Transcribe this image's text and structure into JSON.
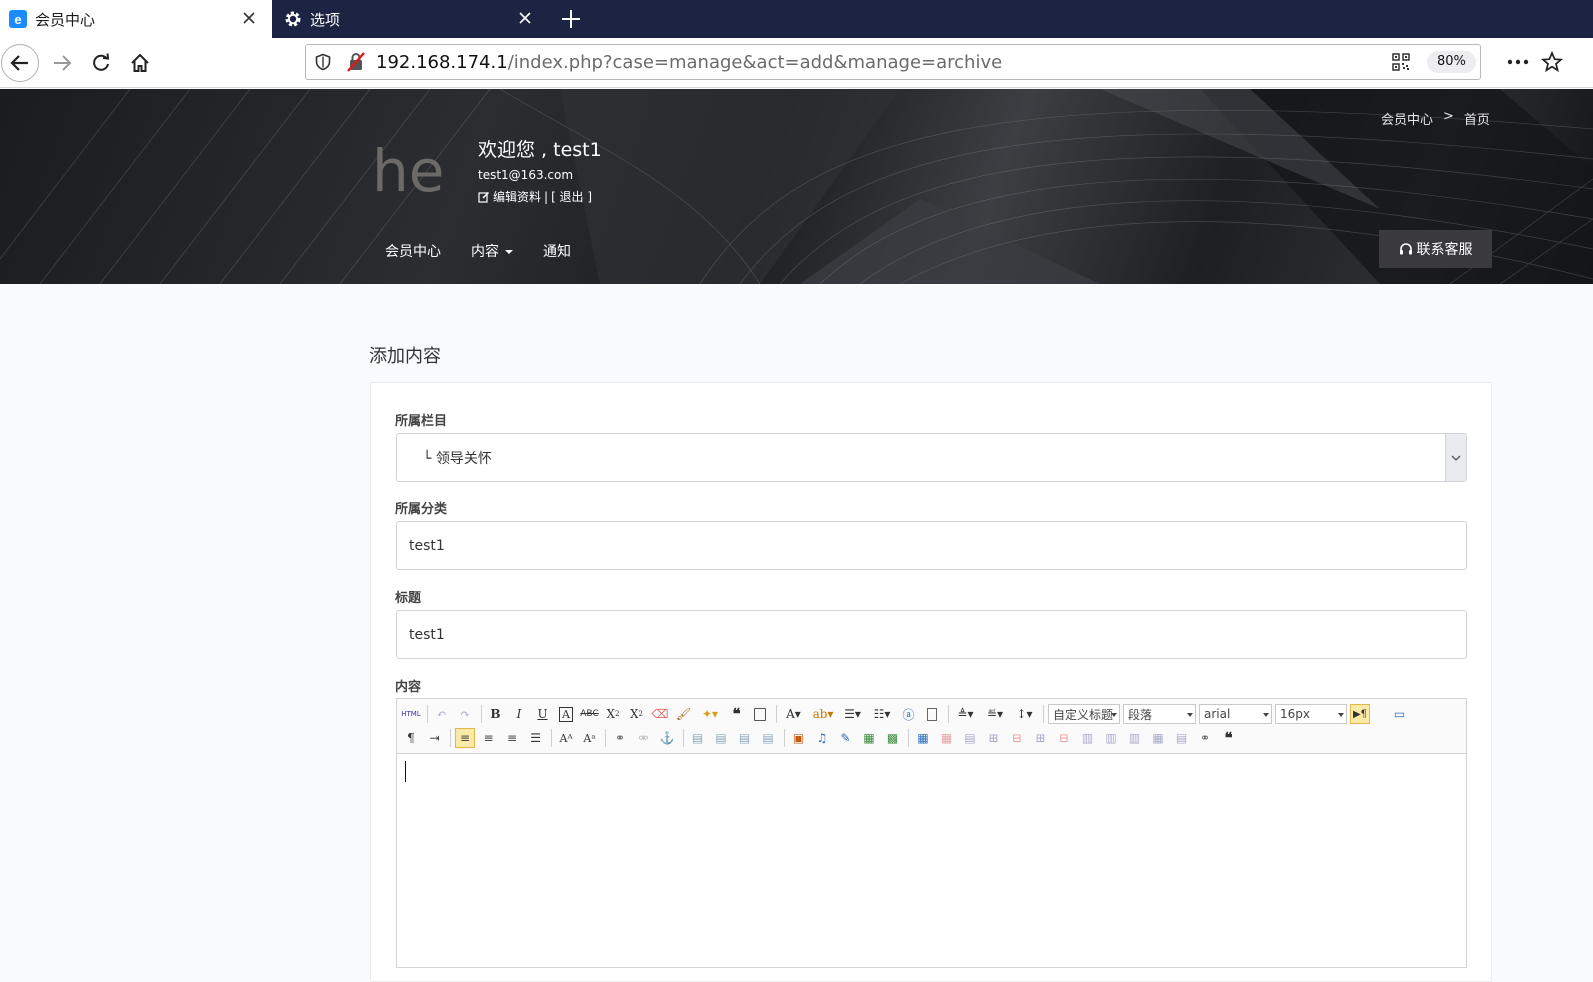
{
  "browser": {
    "tabs": [
      {
        "title": "会员中心",
        "active": true
      },
      {
        "title": "选项",
        "active": false
      }
    ],
    "url_host": "192.168.174.1",
    "url_path": "/index.php?case=manage&act=add&manage=archive",
    "zoom": "80%"
  },
  "header": {
    "logo_text": "hea",
    "welcome": "欢迎您 , test1",
    "email": "test1@163.com",
    "edit_profile": "编辑资料",
    "separator": "|",
    "logout": "[ 退出 ]",
    "breadcrumb": [
      "会员中心",
      ">",
      "首页"
    ],
    "nav": [
      {
        "label": "会员中心",
        "has_caret": false
      },
      {
        "label": "内容",
        "has_caret": true
      },
      {
        "label": "通知",
        "has_caret": false
      }
    ],
    "service_button": "联系客服"
  },
  "main": {
    "page_title": "添加内容",
    "form": {
      "category_label": "所属栏目",
      "category_value": "└ 领导关怀",
      "type_label": "所属分类",
      "type_value": "test1",
      "title_label": "标题",
      "title_value": "test1",
      "content_label": "内容"
    }
  },
  "editor": {
    "heading_select": "自定义标题",
    "paragraph_select": "段落",
    "font_select": "arial",
    "size_select": "16px",
    "html_button": "HTML",
    "row1_buttons": [
      "undo",
      "redo",
      "bold",
      "italic",
      "underline",
      "fontborder",
      "strikethrough",
      "superscript",
      "subscript",
      "removeformat",
      "formatmatch",
      "autotypeset",
      "blockquote",
      "pasteplain",
      "forecolor",
      "backcolor",
      "insertorderedlist",
      "insertunorderedlist",
      "selectall",
      "cleardoc",
      "rowspacingtop",
      "rowspacingbottom",
      "lineheight"
    ],
    "row2_buttons": [
      "directionality-ltr",
      "indent",
      "justify-left",
      "justify-center",
      "justify-right",
      "justify-justify",
      "touppercase",
      "tolowercase",
      "link",
      "unlink",
      "anchor",
      "image-none",
      "image-left",
      "image-right",
      "image-center",
      "simpleupload",
      "insertvideo",
      "attachment",
      "map",
      "insertframe",
      "inserttable",
      "deletetable",
      "insertparagraphbeforetable",
      "insertrow",
      "deleterow",
      "insertcol",
      "deletecol",
      "mergecells",
      "mergeright",
      "mergedown",
      "splittocells",
      "splittorows",
      "splittocols",
      "charts",
      "blockquote2"
    ]
  }
}
